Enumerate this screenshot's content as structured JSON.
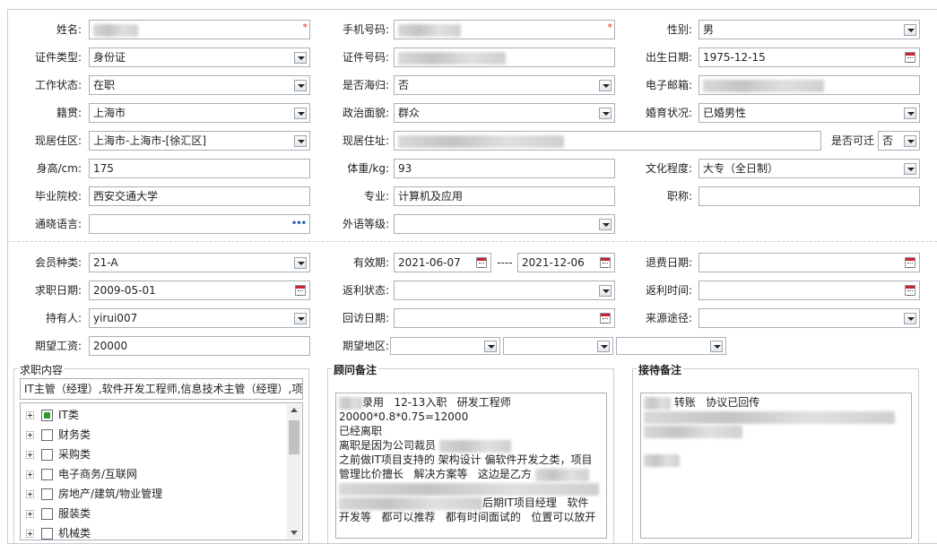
{
  "form": {
    "name_label": "姓名:",
    "phone_label": "手机号码:",
    "gender_label": "性别:",
    "gender_value": "男",
    "idtype_label": "证件类型:",
    "idtype_value": "身份证",
    "idno_label": "证件号码:",
    "birth_label": "出生日期:",
    "birth_value": "1975-12-15",
    "workstatus_label": "工作状态:",
    "workstatus_value": "在职",
    "overseas_label": "是否海归:",
    "overseas_value": "否",
    "email_label": "电子邮箱:",
    "native_label": "籍贯:",
    "native_value": "上海市",
    "political_label": "政治面貌:",
    "political_value": "群众",
    "marital_label": "婚育状况:",
    "marital_value": "已婚男性",
    "residence_label": "现居住区:",
    "residence_value": "上海市-上海市-[徐汇区]",
    "address_label": "现居住址:",
    "relocate_label": "是否可迁",
    "relocate_value": "否",
    "height_label": "身高/cm:",
    "height_value": "175",
    "weight_label": "体重/kg:",
    "weight_value": "93",
    "education_label": "文化程度:",
    "education_value": "大专（全日制）",
    "school_label": "毕业院校:",
    "school_value": "西安交通大学",
    "major_label": "专业:",
    "major_value": "计算机及应用",
    "title_label": "职称:",
    "language_label": "通晓语言:",
    "language_btn": "•••",
    "foreign_label": "外语等级:"
  },
  "member": {
    "type_label": "会员种类:",
    "type_value": "21-A",
    "valid_label": "有效期:",
    "valid_from": "2021-06-07",
    "valid_sep": "----",
    "valid_to": "2021-12-06",
    "refund_label": "退费日期:",
    "apply_label": "求职日期:",
    "apply_value": "2009-05-01",
    "rebate_status_label": "返利状态:",
    "rebate_time_label": "返利时间:",
    "holder_label": "持有人:",
    "holder_value": "yirui007",
    "revisit_label": "回访日期:",
    "source_label": "来源途径:",
    "salary_label": "期望工资:",
    "salary_value": "20000",
    "region_label": "期望地区:"
  },
  "job": {
    "title": "求职内容",
    "summary": "IT主管（经理）,软件开发工程师,信息技术主管（经理）,项",
    "tree": [
      "IT类",
      "财务类",
      "采购类",
      "电子商务/互联网",
      "房地产/建筑/物业管理",
      "服装类",
      "机械类"
    ]
  },
  "consultant": {
    "title": "顾问备注",
    "line1": "录用   12-13入职   研发工程师",
    "line2": "20000*0.8*0.75=12000",
    "line3": "已经离职",
    "line4": "离职是因为公司裁员",
    "line5": "之前做IT项目支持的 架构设计 偏软件开发之类，项目",
    "line6": "管理比价擅长   解决方案等   这边是乙方",
    "line7": "后期IT项目经理   软件",
    "line8": "开发等   都可以推荐   都有时间面试的   位置可以放开"
  },
  "reception": {
    "title": "接待备注",
    "line1": "转账   协议已回传"
  }
}
